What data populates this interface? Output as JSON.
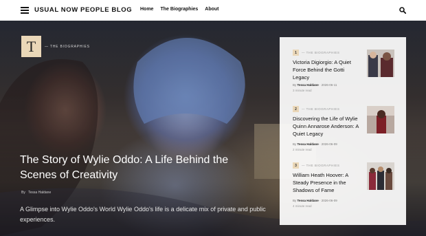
{
  "header": {
    "site_title": "USUAL NOW PEOPLE BLOG",
    "nav": [
      "Home",
      "The Biographies",
      "About"
    ]
  },
  "hero": {
    "badge_letter": "T",
    "category": "— THE BIOGRAPHIES",
    "title": "The Story of Wylie Oddo: A Life Behind the Scenes of Creativity",
    "by": "By",
    "author": "Tessa Haldane",
    "excerpt": "A Glimpse into Wylie Oddo's World Wylie Oddo's life is a delicate mix of private and public experiences."
  },
  "sidebar": {
    "posts": [
      {
        "number": "1",
        "category": "— THE BIOGRAPHIES",
        "title": "Victoria Digiorgio: A Quiet Force Behind the Gotti Legacy",
        "by": "By",
        "author": "Tessa Haldane",
        "date": "2026-06-11",
        "read_time": "3 minute read"
      },
      {
        "number": "2",
        "category": "— THE BIOGRAPHIES",
        "title": "Discovering the Life of Wylie Quinn Annarose Anderson: A Quiet Legacy",
        "by": "By",
        "author": "Tessa Haldane",
        "date": "2026-06-09",
        "read_time": "2 minute read"
      },
      {
        "number": "3",
        "category": "— THE BIOGRAPHIES",
        "title": "William Heath Hoover: A Steady Presence in the Shadows of Fame",
        "by": "By",
        "author": "Tessa Haldane",
        "date": "2026-06-09",
        "read_time": "4 minute read"
      }
    ]
  },
  "colors": {
    "accent": "#ead7b8",
    "header_bg": "#ffffff",
    "text_dark": "#111111"
  },
  "icons": [
    "menu-icon",
    "search-icon"
  ]
}
